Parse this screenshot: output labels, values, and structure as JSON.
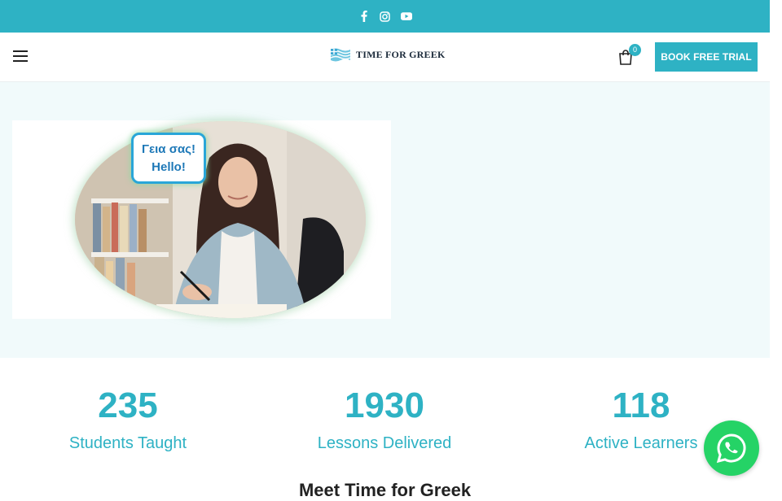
{
  "topbar": {
    "background": "#2eb2c4",
    "social": [
      {
        "icon": "facebook-icon"
      },
      {
        "icon": "instagram-icon"
      },
      {
        "icon": "youtube-icon"
      }
    ]
  },
  "header": {
    "logo_text": "TIME FOR GREEK",
    "cart_count": "0",
    "cta_label": "BOOK FREE TRIAL"
  },
  "hero": {
    "bubble_line1": "Γεια σας!",
    "bubble_line2": "Hello!"
  },
  "stats": [
    {
      "value": "235",
      "label": "Students Taught"
    },
    {
      "value": "1930",
      "label": "Lessons Delivered"
    },
    {
      "value": "118",
      "label": "Active Learners"
    }
  ],
  "next_section": {
    "heading": "Meet Time for Greek"
  },
  "colors": {
    "accent": "#2eb2c4",
    "whatsapp": "#25d366"
  }
}
